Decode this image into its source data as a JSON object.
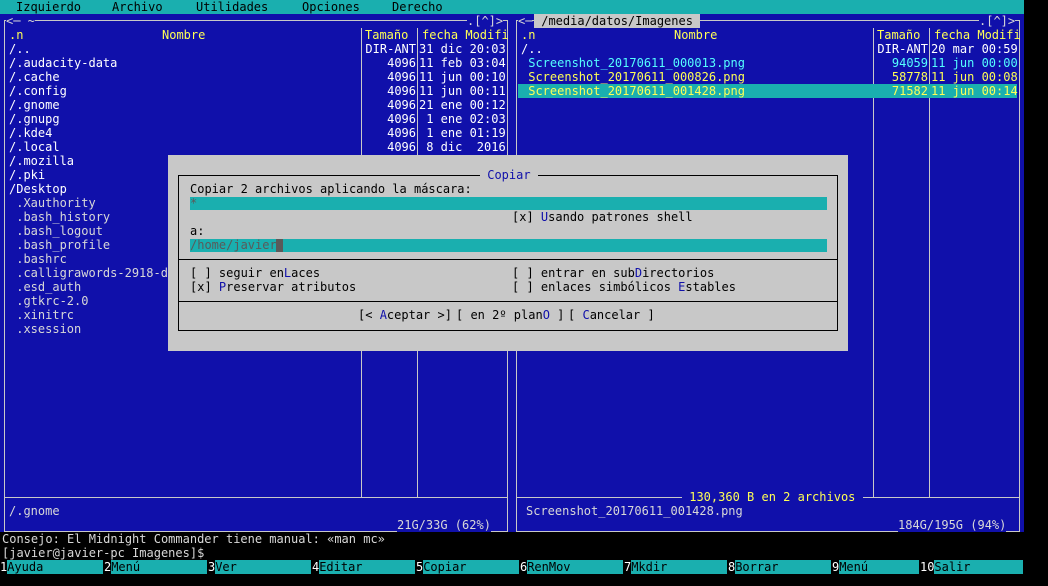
{
  "menubar": {
    "items": [
      "Izquierdo",
      "Archivo",
      "Utilidades",
      "Opciones",
      "Derecho"
    ]
  },
  "left_panel": {
    "corner_left": "<─ ~",
    "corner_right": ".[^]>",
    "col_n": ".n",
    "col_name": "Nombre",
    "col_size": "Tamaño",
    "col_date": "fecha Modifi",
    "rows": [
      {
        "name": "/..",
        "size": "DIR-ANT",
        "date": "31 dic 20:03",
        "style": "white"
      },
      {
        "name": "/.audacity-data",
        "size": "4096",
        "date": "11 feb 03:04",
        "style": "white"
      },
      {
        "name": "/.cache",
        "size": "4096",
        "date": "11 jun 00:10",
        "style": "white"
      },
      {
        "name": "/.config",
        "size": "4096",
        "date": "11 jun 00:11",
        "style": "white"
      },
      {
        "name": "/.gnome",
        "size": "4096",
        "date": "21 ene 00:12",
        "style": "white"
      },
      {
        "name": "/.gnupg",
        "size": "4096",
        "date": " 1 ene 02:03",
        "style": "white"
      },
      {
        "name": "/.kde4",
        "size": "4096",
        "date": " 1 ene 01:19",
        "style": "white"
      },
      {
        "name": "/.local",
        "size": "4096",
        "date": " 8 dic  2016",
        "style": "white"
      },
      {
        "name": "/.mozilla",
        "size": "",
        "date": "",
        "style": "white"
      },
      {
        "name": "/.pki",
        "size": "",
        "date": "",
        "style": "white"
      },
      {
        "name": "/Desktop",
        "size": "",
        "date": "",
        "style": "white"
      },
      {
        "name": " .Xauthority",
        "size": "",
        "date": "",
        "style": "gray"
      },
      {
        "name": " .bash_history",
        "size": "",
        "date": "",
        "style": "gray"
      },
      {
        "name": " .bash_logout",
        "size": "",
        "date": "",
        "style": "gray"
      },
      {
        "name": " .bash_profile",
        "size": "",
        "date": "",
        "style": "gray"
      },
      {
        "name": " .bashrc",
        "size": "",
        "date": "",
        "style": "gray"
      },
      {
        "name": " .calligrawords-2918-do",
        "size": "",
        "date": "",
        "style": "gray"
      },
      {
        "name": " .esd_auth",
        "size": "",
        "date": "",
        "style": "gray"
      },
      {
        "name": " .gtkrc-2.0",
        "size": "",
        "date": "",
        "style": "gray"
      },
      {
        "name": " .xinitrc",
        "size": "",
        "date": "",
        "style": "gray"
      },
      {
        "name": " .xsession",
        "size": "",
        "date": "",
        "style": "gray"
      }
    ],
    "mini_status": "/.gnome",
    "disk": "21G/33G (62%)"
  },
  "right_panel": {
    "corner_left": "<─",
    "path": " /media/datos/Imagenes ",
    "corner_right": ".[^]>",
    "col_n": ".n",
    "col_name": "Nombre",
    "col_size": "Tamaño",
    "col_date": "fecha Modifi",
    "rows": [
      {
        "name": "/..",
        "size": "DIR-ANT",
        "date": "20 mar 00:59",
        "style": "white"
      },
      {
        "name": " Screenshot_20170611_000013.png",
        "size": "94059",
        "date": "11 jun 00:00",
        "style": "cyan"
      },
      {
        "name": " Screenshot_20170611_000826.png",
        "size": "58778",
        "date": "11 jun 00:08",
        "style": "yellow"
      },
      {
        "name": " Screenshot_20170611_001428.png",
        "size": "71582",
        "date": "11 jun 00:14",
        "style": "selected"
      }
    ],
    "summary": " 130,360 B en 2 archivos ",
    "mini_status": "Screenshot_20170611_001428.png",
    "disk": "184G/195G (94%)"
  },
  "dialog": {
    "title": " Copiar ",
    "prompt": "Copiar 2 archivos aplicando la máscara:",
    "mask_value": "*",
    "shell_check": "[x] ",
    "shell_hot": "U",
    "shell_rest": "sando patrones shell",
    "dest_label": "a:",
    "dest_value": "/home/javier",
    "opt1_pre": "[ ] seguir en",
    "opt1_hot": "L",
    "opt1_post": "aces",
    "opt2_pre": "[ ] entrar en sub",
    "opt2_hot": "D",
    "opt2_post": "irectorios",
    "opt3_pre": "[x] ",
    "opt3_hot": "P",
    "opt3_post": "reservar atributos",
    "opt4_pre": "[ ] enlaces simbólicos ",
    "opt4_hot": "E",
    "opt4_post": "stables",
    "btn_ok_pre": "[< ",
    "btn_ok_hot": "A",
    "btn_ok_post": "ceptar >]",
    "btn_bg_pre": "[ en 2º plan",
    "btn_bg_hot": "O",
    "btn_bg_post": " ]",
    "btn_cancel_pre": "[ ",
    "btn_cancel_hot": "C",
    "btn_cancel_post": "ancelar ]"
  },
  "hint": "Consejo: El Midnight Commander tiene manual: «man mc»",
  "prompt": "[javier@javier-pc Imagenes]$",
  "fkeys": [
    {
      "num": "1",
      "label": "Ayuda"
    },
    {
      "num": "2",
      "label": "Menú"
    },
    {
      "num": "3",
      "label": "Ver"
    },
    {
      "num": "4",
      "label": "Editar"
    },
    {
      "num": "5",
      "label": "Copiar"
    },
    {
      "num": "6",
      "label": "RenMov"
    },
    {
      "num": "7",
      "label": "Mkdir"
    },
    {
      "num": "8",
      "label": "Borrar"
    },
    {
      "num": "9",
      "label": "Menú"
    },
    {
      "num": "10",
      "label": "Salir"
    }
  ],
  "colors": {
    "panel": "#1010aa",
    "cyan_bar": "#1aafaf",
    "dialog": "#c8c8c8",
    "header": "#ffff55"
  }
}
